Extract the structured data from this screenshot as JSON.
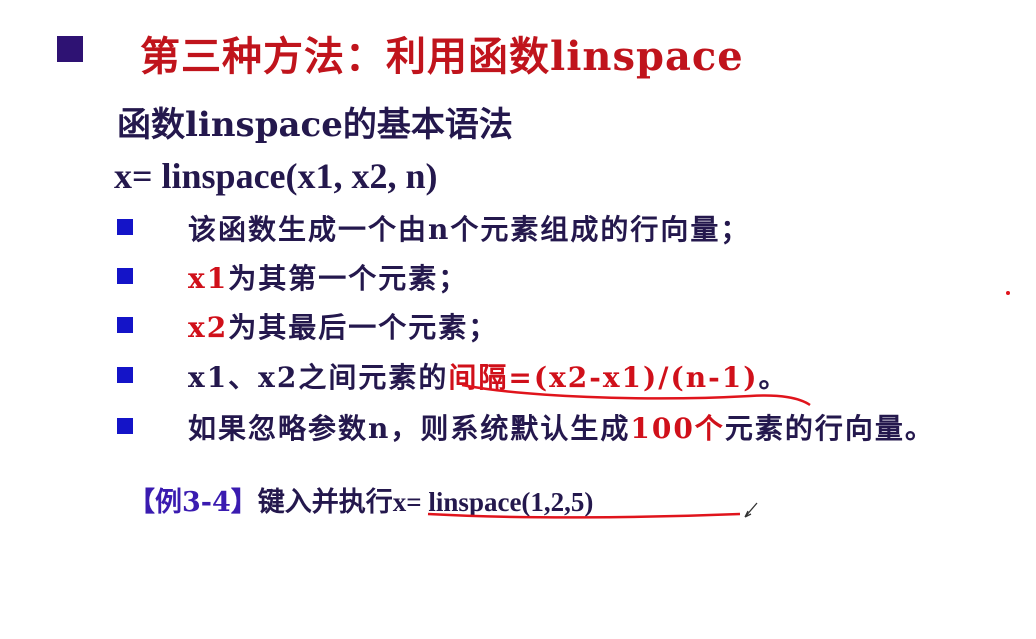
{
  "title": "第三种方法：利用函数linspace",
  "subtitle": "函数linspace的基本语法",
  "syntax": "x= linspace(x1, x2, n)",
  "bullets": [
    {
      "parts": [
        {
          "text": "该函数生成一个由n个元素组成的行向量；",
          "red": false
        }
      ]
    },
    {
      "parts": [
        {
          "text": "x1",
          "red": true
        },
        {
          "text": "为其第一个元素；",
          "red": false
        }
      ]
    },
    {
      "parts": [
        {
          "text": "x2",
          "red": true
        },
        {
          "text": "为其最后一个元素；",
          "red": false
        }
      ]
    },
    {
      "parts": [
        {
          "text": "x1、x2之间元素的",
          "red": false
        },
        {
          "text": "间隔=(x2-x1)/(n-1)",
          "red": true
        },
        {
          "text": "。",
          "red": false
        }
      ]
    },
    {
      "parts": [
        {
          "text": "如果忽略参数n，则系统默认生成",
          "red": false
        },
        {
          "text": "100个",
          "red": true
        },
        {
          "text": "元素的行向量。",
          "red": false
        }
      ]
    }
  ],
  "example": {
    "tag": "【例3-4】",
    "text": "键入并执行",
    "code": "x= linspace(1,2,5)"
  },
  "colors": {
    "title": "#c0141c",
    "body": "#24184d",
    "highlight": "#d0101a",
    "bullet": "#1414c8",
    "main_bullet": "#2e1273"
  }
}
